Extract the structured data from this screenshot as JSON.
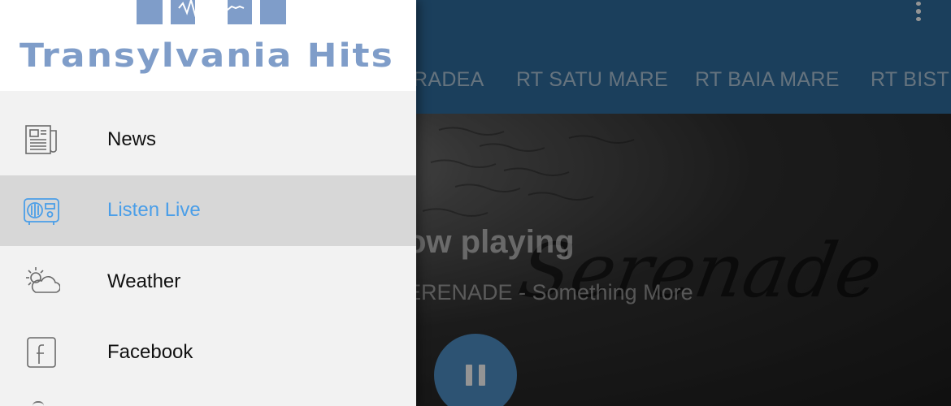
{
  "app": {
    "tabs": [
      {
        "label": "RADEA"
      },
      {
        "label": "RT SATU MARE"
      },
      {
        "label": "RT BAIA MARE"
      },
      {
        "label": "RT BISTR"
      }
    ],
    "player": {
      "now_playing_label": "ow playing",
      "track_info": "ERENADE - Something More",
      "artwork_text": "Serenade",
      "pause_button_icon": "pause-icon"
    },
    "overflow_menu_icon": "more-vertical-icon"
  },
  "drawer": {
    "logo": {
      "text": "Transylvania Hits",
      "color": "#7f9dc9"
    },
    "items": [
      {
        "label": "News",
        "icon": "newspaper-icon",
        "active": false
      },
      {
        "label": "Listen Live",
        "icon": "radio-icon",
        "active": true
      },
      {
        "label": "Weather",
        "icon": "weather-icon",
        "active": false
      },
      {
        "label": "Facebook",
        "icon": "facebook-icon",
        "active": false
      }
    ]
  },
  "colors": {
    "app_bar": "#2f6d9f",
    "accent": "#4a9ee8",
    "active_row": "#d7d7d7",
    "fab": "#4f8fc6"
  }
}
